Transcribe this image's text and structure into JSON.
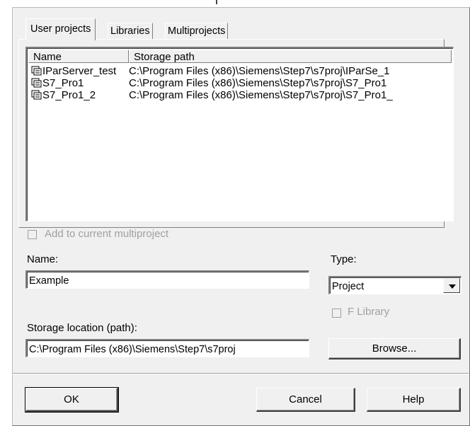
{
  "tabs": [
    {
      "label": "User projects",
      "active": true
    },
    {
      "label": "Libraries",
      "active": false
    },
    {
      "label": "Multiprojects",
      "active": false
    }
  ],
  "list": {
    "columns": [
      "Name",
      "Storage path"
    ],
    "rows": [
      {
        "name": "IParServer_test",
        "path": "C:\\Program Files (x86)\\Siemens\\Step7\\s7proj\\IParSe_1",
        "icon": "project-icon"
      },
      {
        "name": "S7_Pro1",
        "path": "C:\\Program Files (x86)\\Siemens\\Step7\\s7proj\\S7_Pro1",
        "icon": "project-icon"
      },
      {
        "name": "S7_Pro1_2",
        "path": "C:\\Program Files (x86)\\Siemens\\Step7\\s7proj\\S7_Pro1_",
        "icon": "project-icon"
      }
    ]
  },
  "add_to_multiproject": {
    "label": "Add to current multiproject",
    "checked": false,
    "enabled": false
  },
  "name": {
    "label": "Name:",
    "value": "Example"
  },
  "type": {
    "label": "Type:",
    "value": "Project"
  },
  "f_library": {
    "label": "F Library",
    "checked": false,
    "enabled": false
  },
  "storage": {
    "label": "Storage location (path):",
    "value": "C:\\Program Files (x86)\\Siemens\\Step7\\s7proj"
  },
  "buttons": {
    "browse": "Browse...",
    "ok": "OK",
    "cancel": "Cancel",
    "help": "Help"
  }
}
